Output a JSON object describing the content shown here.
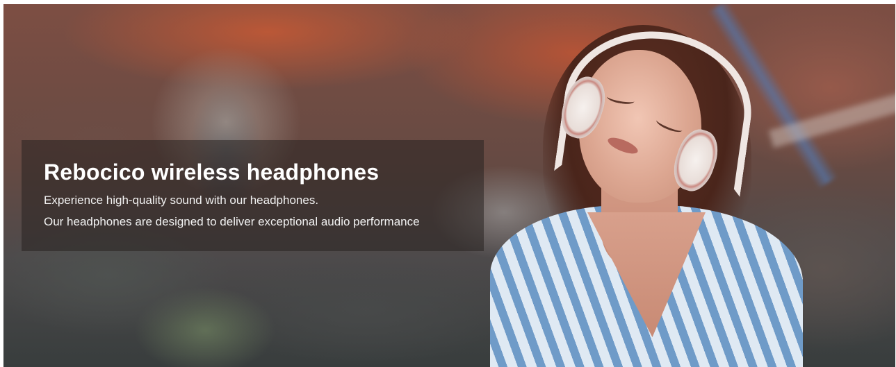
{
  "hero": {
    "title": "Rebocico wireless headphones",
    "description_lines": [
      "Experience high-quality sound with our headphones.",
      "Our headphones are designed to deliver exceptional audio performance"
    ]
  },
  "colors": {
    "panel_overlay": "#282221",
    "title_text": "#ffffff",
    "body_text": "#f2f2f2"
  }
}
